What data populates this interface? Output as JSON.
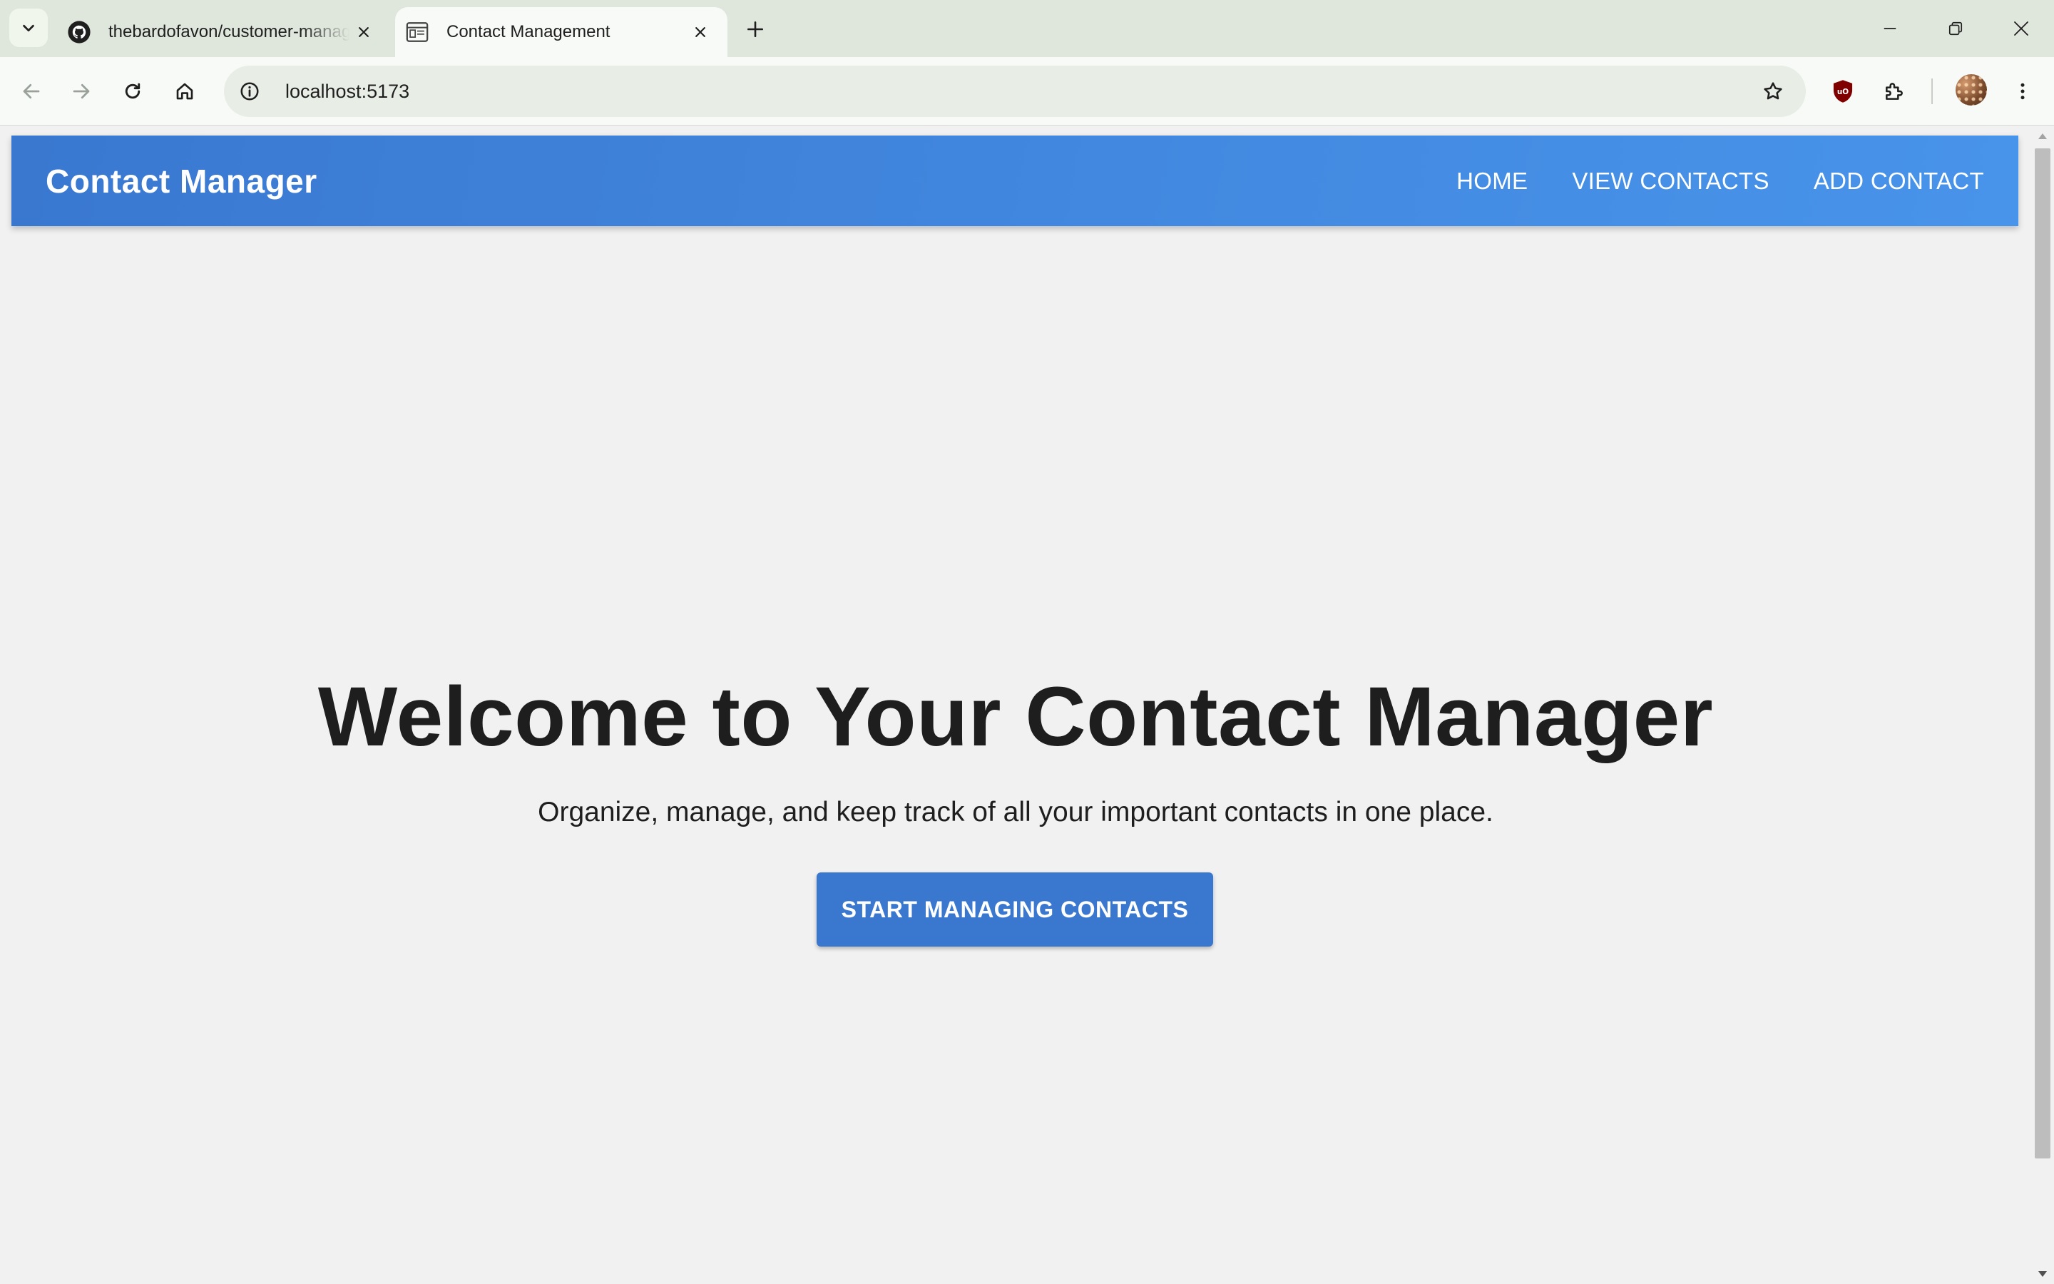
{
  "browser": {
    "tabs": [
      {
        "title": "thebardofavon/customer-management",
        "active": false,
        "favicon": "github-icon"
      },
      {
        "title": "Contact Management",
        "active": true,
        "favicon": "page-icon"
      }
    ],
    "address_bar": {
      "url": "localhost:5173"
    }
  },
  "app": {
    "brand": "Contact Manager",
    "nav": {
      "home": "HOME",
      "view_contacts": "VIEW CONTACTS",
      "add_contact": "ADD CONTACT"
    },
    "hero": {
      "title": "Welcome to Your Contact Manager",
      "subtitle": "Organize, manage, and keep track of all your important contacts in one place.",
      "cta_label": "START MANAGING CONTACTS"
    }
  },
  "colors": {
    "appbar_blue": "#3a78d0",
    "page_background": "#f1f1f1",
    "tabstrip_background": "#dfe7dc",
    "heading_text": "#1e1e1e"
  }
}
